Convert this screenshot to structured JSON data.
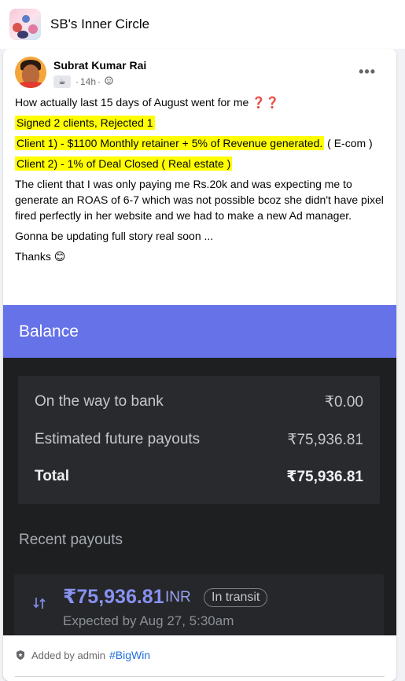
{
  "group": {
    "title": "SB's Inner Circle"
  },
  "post": {
    "author": "Subrat Kumar Rai",
    "time": "14h",
    "separator": "·",
    "more_label": "•••",
    "intro": "How actually last 15 days of August went for me ❓❓",
    "highlight_1": "Signed 2 clients, Rejected 1",
    "highlight_2": "Client 1) - $1100 Monthly retainer + 5% of Revenue generated.",
    "highlight_2_tail": " ( E-com )",
    "highlight_3": "Client 2) - 1% of Deal Closed ( Real estate )",
    "paragraph": "The client that I was only paying me Rs.20k and was expecting me to generate an ROAS of 6-7 which was not possible bcoz she didn't have pixel fired perfectly in her website and we had to make a new Ad manager.",
    "update": "Gonna be updating full story real soon ...",
    "thanks": "Thanks 😊"
  },
  "payout_screenshot": {
    "header": "Balance",
    "rows": [
      {
        "label": "On the way to bank",
        "value": "₹0.00"
      },
      {
        "label": "Estimated future payouts",
        "value": "₹75,936.81"
      },
      {
        "label": "Total",
        "value": "₹75,936.81"
      }
    ],
    "recent_label": "Recent payouts",
    "transaction": {
      "amount": "₹75,936.81",
      "currency": "INR",
      "status": "In transit",
      "expected": "Expected by Aug 27, 5:30am"
    }
  },
  "footer": {
    "added_by": "Added by admin",
    "hashtag": "#BigWin"
  },
  "colors": {
    "highlight": "#ffff00",
    "balance_header": "#6572e8",
    "hashtag": "#216fdb"
  }
}
